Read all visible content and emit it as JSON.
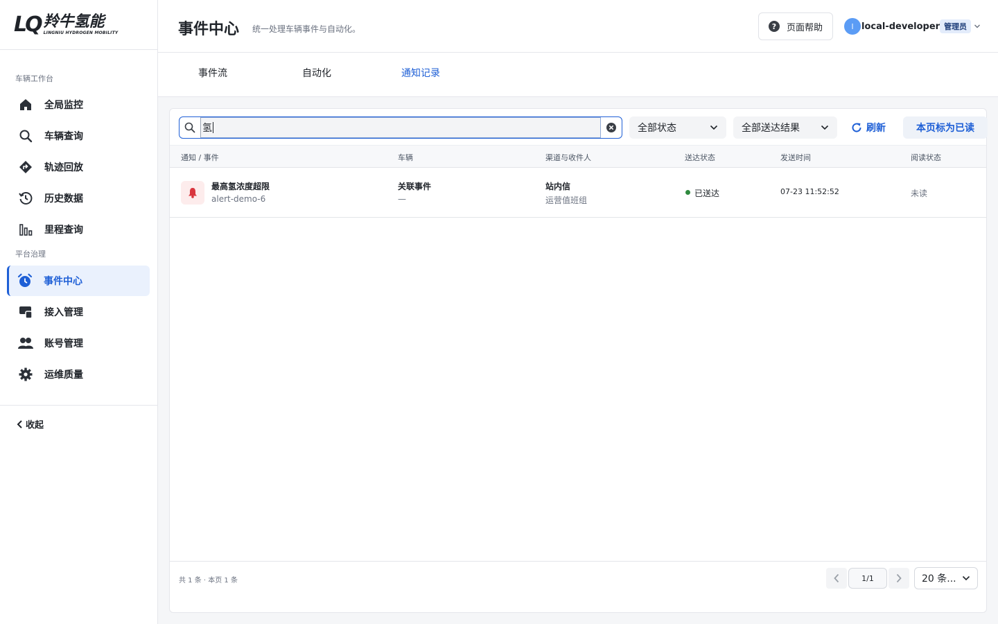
{
  "brand": {
    "name_cn": "羚牛氢能",
    "name_en": "LINGNIU HYDROGEN MOBILITY",
    "mark": "LQ"
  },
  "sidebar": {
    "section1": "车辆工作台",
    "section2": "平台治理",
    "items": [
      {
        "label": "全局监控",
        "icon": "home-icon"
      },
      {
        "label": "车辆查询",
        "icon": "search-icon"
      },
      {
        "label": "轨迹回放",
        "icon": "route-icon"
      },
      {
        "label": "历史数据",
        "icon": "history-icon"
      },
      {
        "label": "里程查询",
        "icon": "bar-chart-icon"
      },
      {
        "label": "事件中心",
        "icon": "alarm-clock-icon",
        "active": true
      },
      {
        "label": "接入管理",
        "icon": "device-icon"
      },
      {
        "label": "账号管理",
        "icon": "users-icon"
      },
      {
        "label": "运维质量",
        "icon": "gear-icon"
      }
    ],
    "collapse": "收起"
  },
  "header": {
    "title": "事件中心",
    "subtitle": "统一处理车辆事件与自动化。",
    "help": "页面帮助",
    "user": {
      "avatar_letter": "l",
      "name": "local-developer",
      "role": "管理员"
    }
  },
  "tabs": [
    {
      "label": "事件流"
    },
    {
      "label": "自动化"
    },
    {
      "label": "通知记录",
      "active": true
    }
  ],
  "toolbar": {
    "search_value": "氢",
    "status_select": "全部状态",
    "delivery_select": "全部送达结果",
    "refresh": "刷新",
    "mark_read": "本页标为已读"
  },
  "table": {
    "columns": [
      "通知 / 事件",
      "车辆",
      "渠道与收件人",
      "送达状态",
      "发送时间",
      "阅读状态"
    ],
    "rows": [
      {
        "title": "最高氢浓度超限",
        "event_id": "alert-demo-6",
        "vehicle": "关联事件",
        "vehicle_sub": "—",
        "channel": "站内信",
        "recipient": "运营值班组",
        "delivery": "已送达",
        "time": "07-23 11:52:52",
        "read": "未读"
      }
    ]
  },
  "footer": {
    "summary": "共 1 条 · 本页 1 条",
    "page": "1/1",
    "page_size": "20 条..."
  },
  "colors": {
    "accent": "#1e5fd6",
    "alert": "#d9363e",
    "success": "#2f8a3e"
  }
}
